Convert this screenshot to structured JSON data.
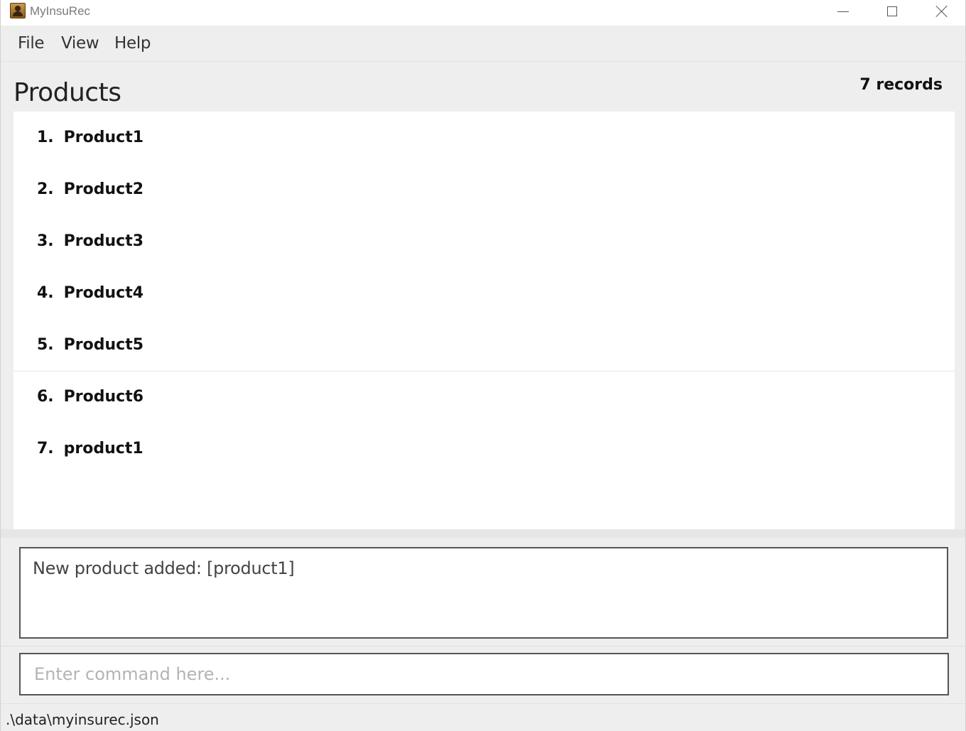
{
  "window": {
    "title": "MyInsuRec",
    "icon": "address-book-icon"
  },
  "menu": {
    "file": "File",
    "view": "View",
    "help": "Help"
  },
  "products_panel": {
    "title": "Products",
    "record_count": "7 records",
    "items": [
      {
        "index": "1.",
        "name": "Product1"
      },
      {
        "index": "2.",
        "name": "Product2"
      },
      {
        "index": "3.",
        "name": "Product3"
      },
      {
        "index": "4.",
        "name": "Product4"
      },
      {
        "index": "5.",
        "name": "Product5"
      },
      {
        "index": "6.",
        "name": "Product6"
      },
      {
        "index": "7.",
        "name": "product1"
      }
    ]
  },
  "result": {
    "message": "New product added: [product1]"
  },
  "command": {
    "value": "",
    "placeholder": "Enter command here..."
  },
  "status": {
    "file_path": ".\\data\\myinsurec.json"
  }
}
